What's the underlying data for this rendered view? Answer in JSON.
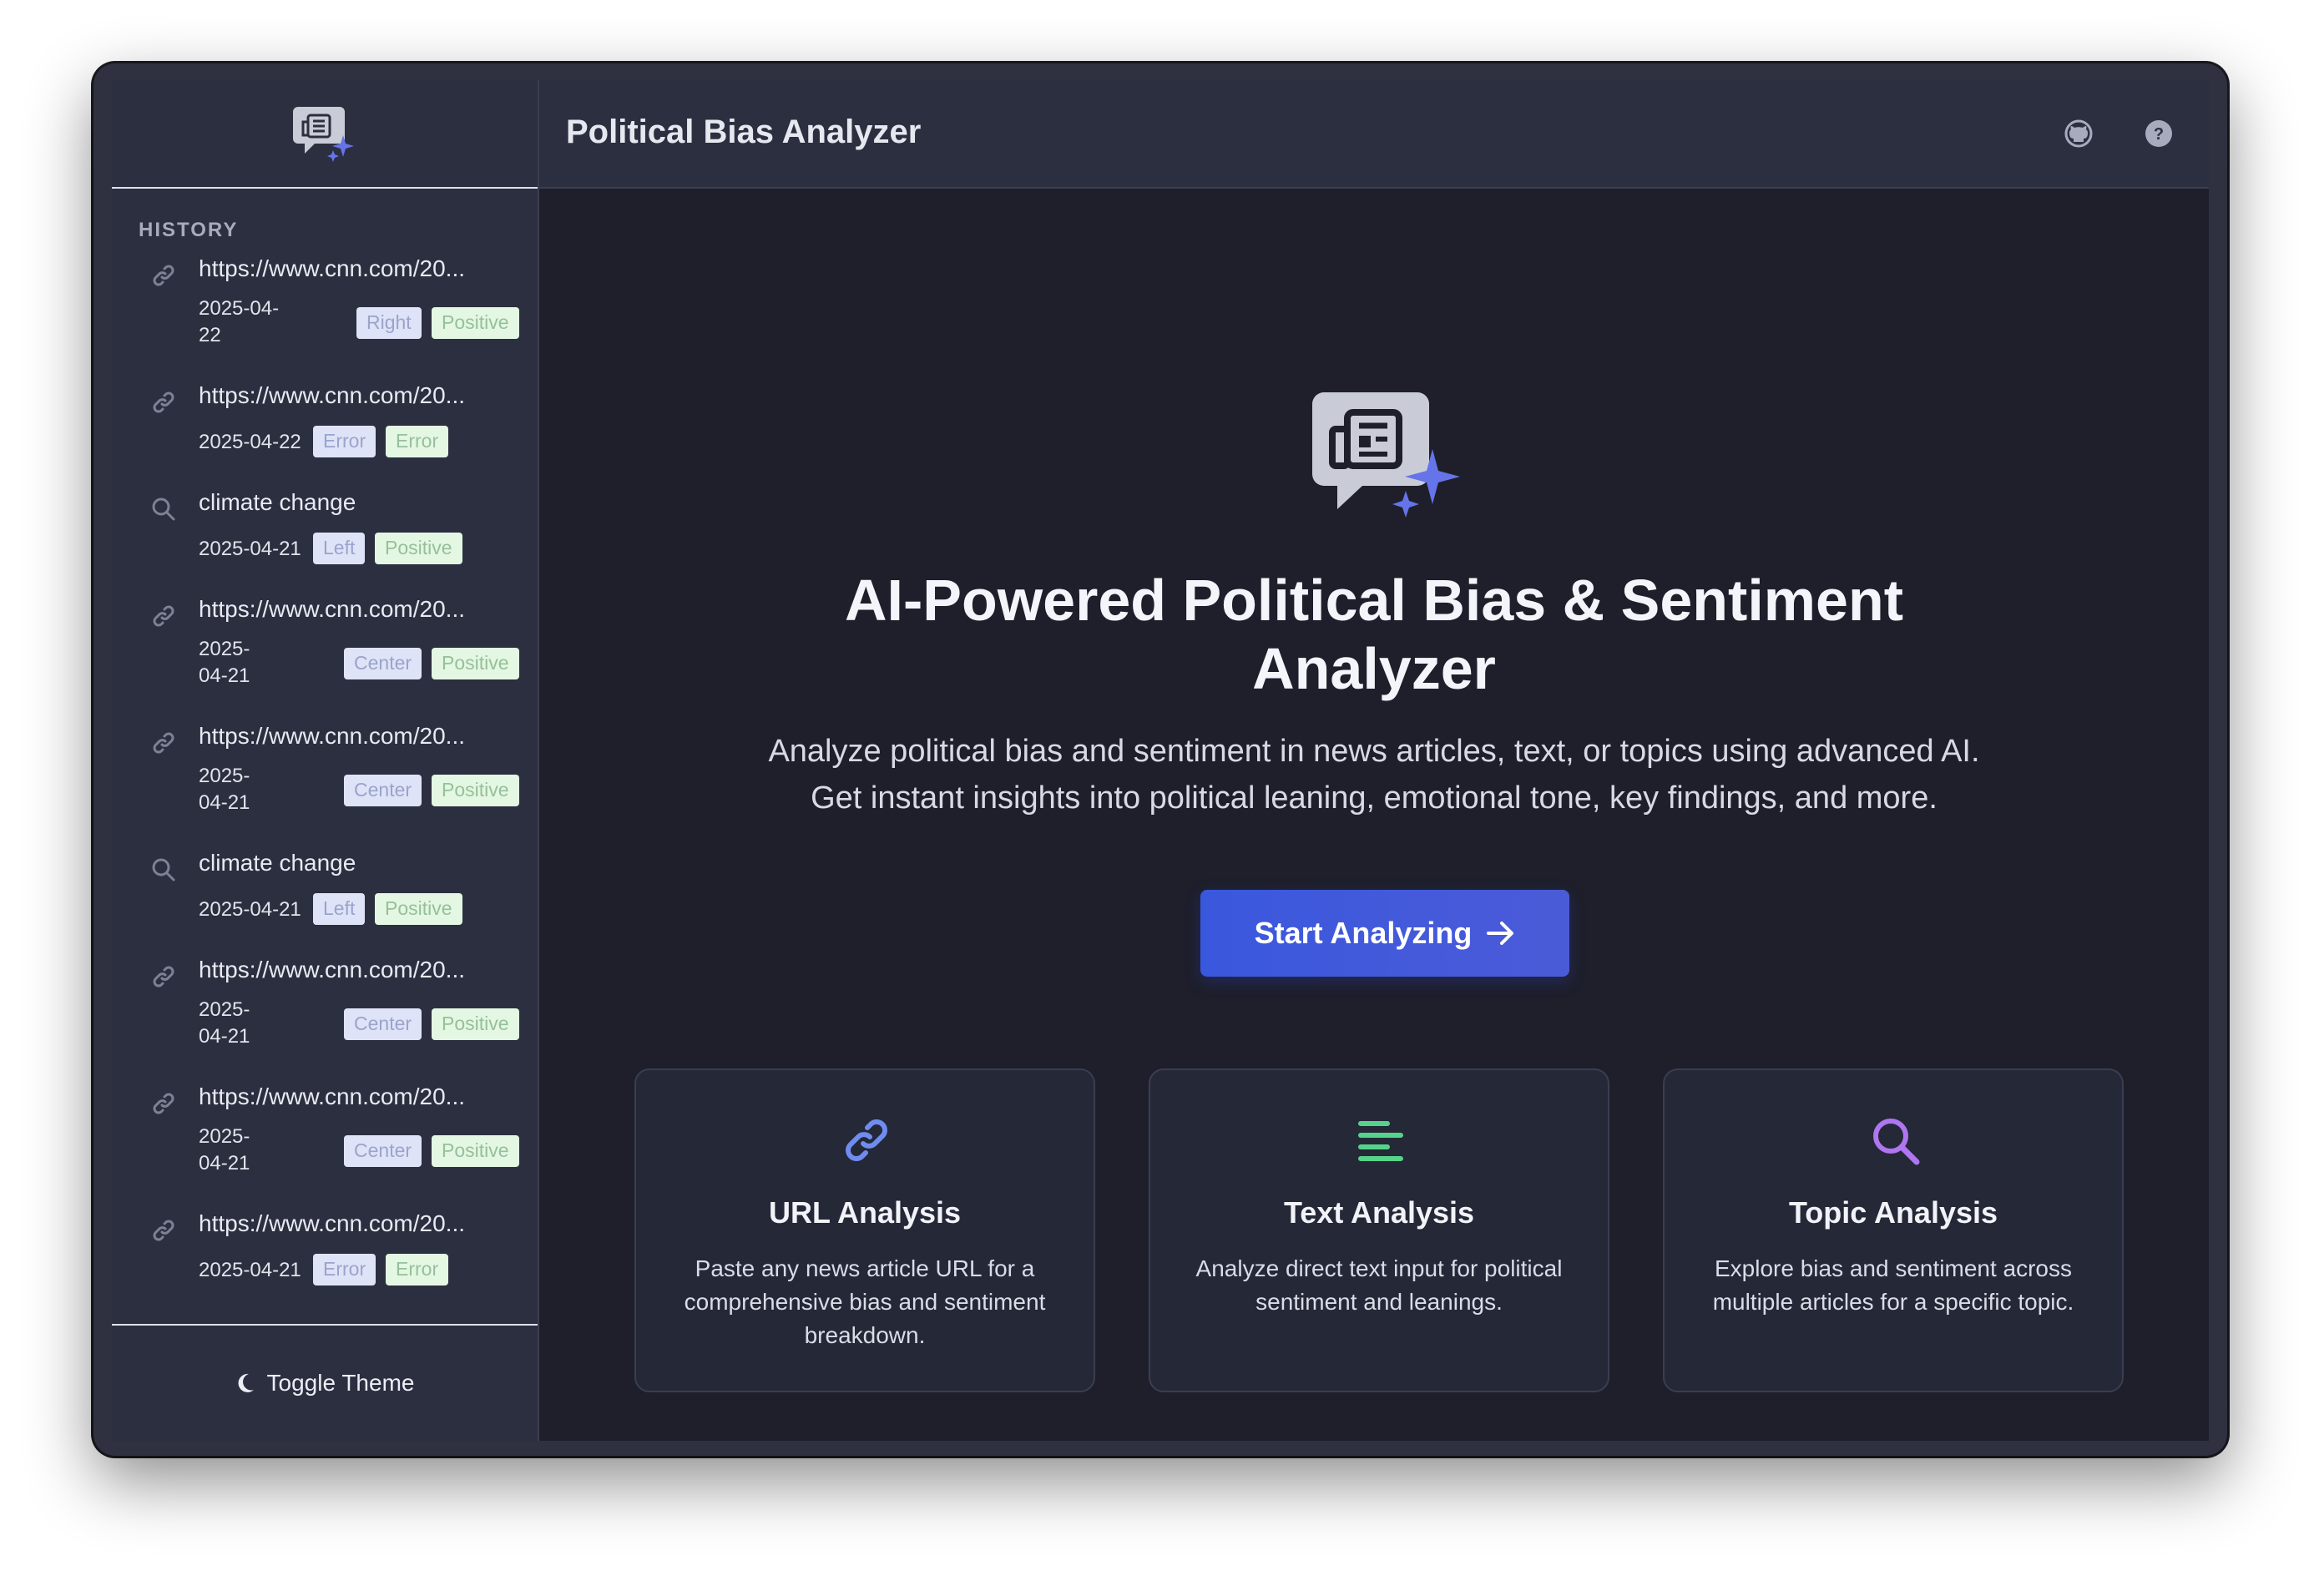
{
  "header": {
    "title": "Political Bias Analyzer"
  },
  "sidebar": {
    "history_label": "HISTORY",
    "toggle_theme": "Toggle Theme",
    "items": [
      {
        "type": "url",
        "title": "https://www.cnn.com/20...",
        "date": "2025-04-22",
        "date_lines": [
          "2025-04-",
          "22"
        ],
        "bias": "Right",
        "sentiment": "Positive"
      },
      {
        "type": "url",
        "title": "https://www.cnn.com/20...",
        "date": "2025-04-22",
        "date_lines": [
          "2025-04-22"
        ],
        "bias": "Error",
        "sentiment": "Error"
      },
      {
        "type": "topic",
        "title": "climate change",
        "date": "2025-04-21",
        "date_lines": [
          "2025-04-21"
        ],
        "bias": "Left",
        "sentiment": "Positive"
      },
      {
        "type": "url",
        "title": "https://www.cnn.com/20...",
        "date": "2025-04-21",
        "date_lines": [
          "2025-",
          "04-21"
        ],
        "bias": "Center",
        "sentiment": "Positive"
      },
      {
        "type": "url",
        "title": "https://www.cnn.com/20...",
        "date": "2025-04-21",
        "date_lines": [
          "2025-",
          "04-21"
        ],
        "bias": "Center",
        "sentiment": "Positive"
      },
      {
        "type": "topic",
        "title": "climate change",
        "date": "2025-04-21",
        "date_lines": [
          "2025-04-21"
        ],
        "bias": "Left",
        "sentiment": "Positive"
      },
      {
        "type": "url",
        "title": "https://www.cnn.com/20...",
        "date": "2025-04-21",
        "date_lines": [
          "2025-",
          "04-21"
        ],
        "bias": "Center",
        "sentiment": "Positive"
      },
      {
        "type": "url",
        "title": "https://www.cnn.com/20...",
        "date": "2025-04-21",
        "date_lines": [
          "2025-",
          "04-21"
        ],
        "bias": "Center",
        "sentiment": "Positive"
      },
      {
        "type": "url",
        "title": "https://www.cnn.com/20...",
        "date": "2025-04-21",
        "date_lines": [
          "2025-04-21"
        ],
        "bias": "Error",
        "sentiment": "Error"
      }
    ]
  },
  "hero": {
    "title_line1": "AI-Powered Political Bias & Sentiment",
    "title_line2": "Analyzer",
    "subtitle_line1": "Analyze political bias and sentiment in news articles, text, or topics using advanced AI.",
    "subtitle_line2": "Get instant insights into political leaning, emotional tone, key findings, and more.",
    "cta_label": "Start Analyzing"
  },
  "features": [
    {
      "icon": "link-icon",
      "title": "URL Analysis",
      "description": "Paste any news article URL for a comprehensive bias and sentiment breakdown.",
      "color": "#6f8cf0"
    },
    {
      "icon": "text-lines-icon",
      "title": "Text Analysis",
      "description": "Analyze direct text input for political sentiment and leanings.",
      "color": "#56d38a"
    },
    {
      "icon": "search-icon",
      "title": "Topic Analysis",
      "description": "Explore bias and sentiment across multiple articles for a specific topic.",
      "color": "#b075f0"
    }
  ],
  "colors": {
    "accent": "#3a58dd",
    "sparkle": "#6574e8",
    "background": "#1e1f2b",
    "sidebar": "#2c2f40"
  },
  "icons": {
    "header_right": [
      "github-icon",
      "help-icon"
    ],
    "theme": "moon-icon"
  }
}
